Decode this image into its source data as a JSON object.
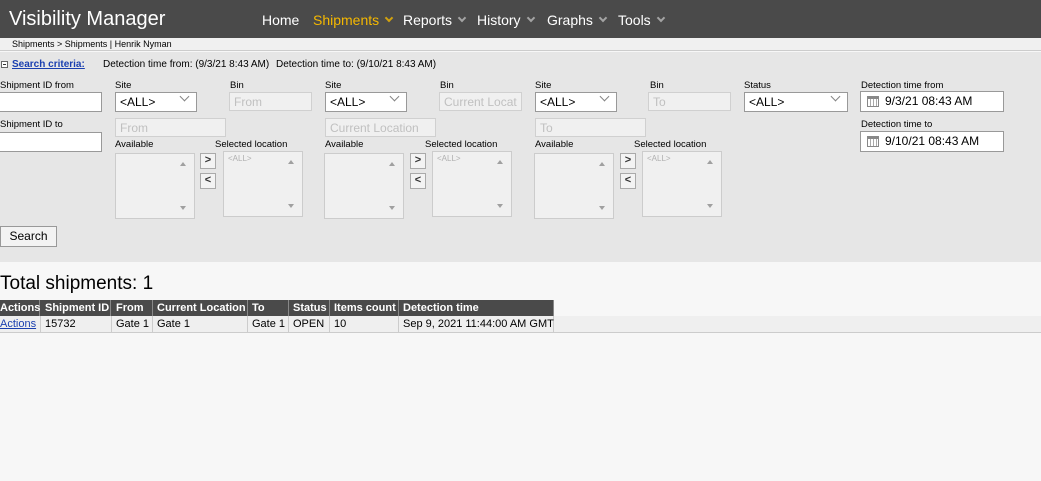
{
  "header": {
    "app_title": "Visibility Manager",
    "nav": [
      {
        "label": "Home"
      },
      {
        "label": "Shipments"
      },
      {
        "label": "Reports"
      },
      {
        "label": "History"
      },
      {
        "label": "Graphs"
      },
      {
        "label": "Tools"
      }
    ],
    "active_color": "#f5b800"
  },
  "breadcrumb": "Shipments > Shipments | Henrik Nyman",
  "criteria": {
    "link": "Search criteria:",
    "from_text": "Detection time from: (9/3/21 8:43 AM)",
    "to_text": "Detection time to: (9/10/21 8:43 AM)"
  },
  "filters": {
    "shipment_id_from_label": "Shipment ID from",
    "shipment_id_to_label": "Shipment ID to",
    "groups": [
      {
        "site_label": "Site",
        "site_value": "<ALL>",
        "bin_label": "Bin",
        "bin_placeholder": "From",
        "loc_placeholder": "From",
        "available_label": "Available",
        "selected_label": "Selected location",
        "selected_ph": "<ALL>"
      },
      {
        "site_label": "Site",
        "site_value": "<ALL>",
        "bin_label": "Bin",
        "bin_placeholder": "Current Locat",
        "loc_placeholder": "Current Location",
        "available_label": "Available",
        "selected_label": "Selected location",
        "selected_ph": "<ALL>"
      },
      {
        "site_label": "Site",
        "site_value": "<ALL>",
        "bin_label": "Bin",
        "bin_placeholder": "To",
        "loc_placeholder": "To",
        "available_label": "Available",
        "selected_label": "Selected location",
        "selected_ph": "<ALL>"
      }
    ],
    "status_label": "Status",
    "status_value": "<ALL>",
    "detection_from_label": "Detection time from",
    "detection_from_value": "9/3/21 08:43 AM",
    "detection_to_label": "Detection time to",
    "detection_to_value": "9/10/21 08:43 AM",
    "move_right": ">",
    "move_left": "<",
    "search_button": "Search"
  },
  "results": {
    "total": "Total shipments: 1",
    "columns": [
      "Actions",
      "Shipment ID",
      "From",
      "Current Location",
      "To",
      "Status",
      "Items count",
      "Detection time"
    ],
    "rows": [
      [
        "Actions",
        "15732",
        "Gate 1",
        "Gate 1",
        "Gate 1",
        "OPEN",
        "10",
        "Sep 9, 2021 11:44:00 AM GMT"
      ]
    ]
  }
}
